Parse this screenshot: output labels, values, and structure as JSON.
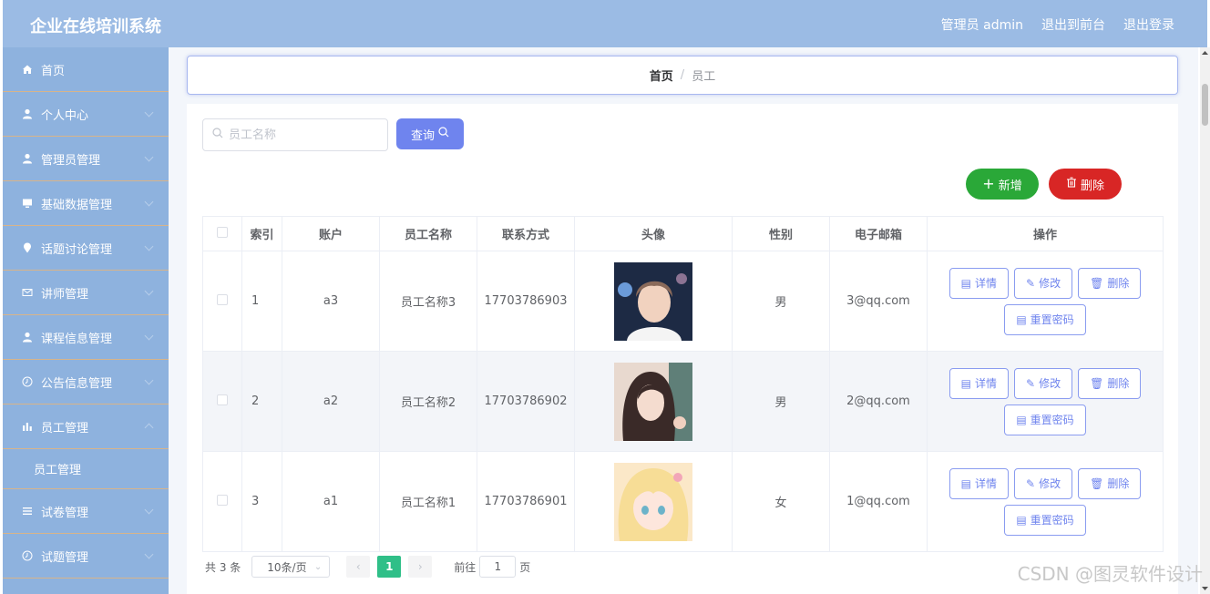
{
  "header": {
    "title": "企业在线培训系统",
    "admin_label": "管理员 admin",
    "front_label": "退出到前台",
    "logout_label": "退出登录"
  },
  "sidebar": {
    "items": [
      {
        "label": "首页",
        "icon": "home-icon"
      },
      {
        "label": "个人中心",
        "icon": "user-icon"
      },
      {
        "label": "管理员管理",
        "icon": "user-icon"
      },
      {
        "label": "基础数据管理",
        "icon": "monitor-icon"
      },
      {
        "label": "话题讨论管理",
        "icon": "location-icon"
      },
      {
        "label": "讲师管理",
        "icon": "mail-icon"
      },
      {
        "label": "课程信息管理",
        "icon": "user-icon"
      },
      {
        "label": "公告信息管理",
        "icon": "clock-icon"
      },
      {
        "label": "员工管理",
        "icon": "bar-chart-icon"
      },
      {
        "label": "员工管理",
        "icon": ""
      },
      {
        "label": "试卷管理",
        "icon": "list-icon"
      },
      {
        "label": "试题管理",
        "icon": "clock-icon"
      }
    ]
  },
  "breadcrumb": {
    "home": "首页",
    "separator": "/",
    "current": "员工"
  },
  "search": {
    "placeholder": "员工名称",
    "value": "",
    "button_label": "查询"
  },
  "actions": {
    "add_label": "新增",
    "delete_label": "删除"
  },
  "table": {
    "columns": [
      "索引",
      "账户",
      "员工名称",
      "联系方式",
      "头像",
      "性别",
      "电子邮箱",
      "操作"
    ],
    "rows": [
      {
        "index": "1",
        "account": "a3",
        "name": "员工名称3",
        "phone": "17703786903",
        "avatar": "avatar-young-man",
        "gender": "男",
        "email": "3@qq.com"
      },
      {
        "index": "2",
        "account": "a2",
        "name": "员工名称2",
        "phone": "17703786902",
        "avatar": "avatar-woman-painting",
        "gender": "男",
        "email": "2@qq.com"
      },
      {
        "index": "3",
        "account": "a1",
        "name": "员工名称1",
        "phone": "17703786901",
        "avatar": "avatar-anime-girl",
        "gender": "女",
        "email": "1@qq.com"
      }
    ],
    "ops": {
      "detail": "详情",
      "edit": "修改",
      "delete": "删除",
      "reset_password": "重置密码"
    }
  },
  "pagination": {
    "total": "共 3 条",
    "page_size": "10条/页",
    "current_page": "1",
    "goto_label": "前往",
    "goto_value": "1",
    "page_unit": "页"
  },
  "watermark": "CSDN @图灵软件设计",
  "colors": {
    "topbar": "#9bbbe4",
    "sidebar": "#8eb2de",
    "primary": "#6f84ee",
    "success": "#2aa838",
    "danger": "#d82625",
    "page_active": "#2fbf88"
  }
}
